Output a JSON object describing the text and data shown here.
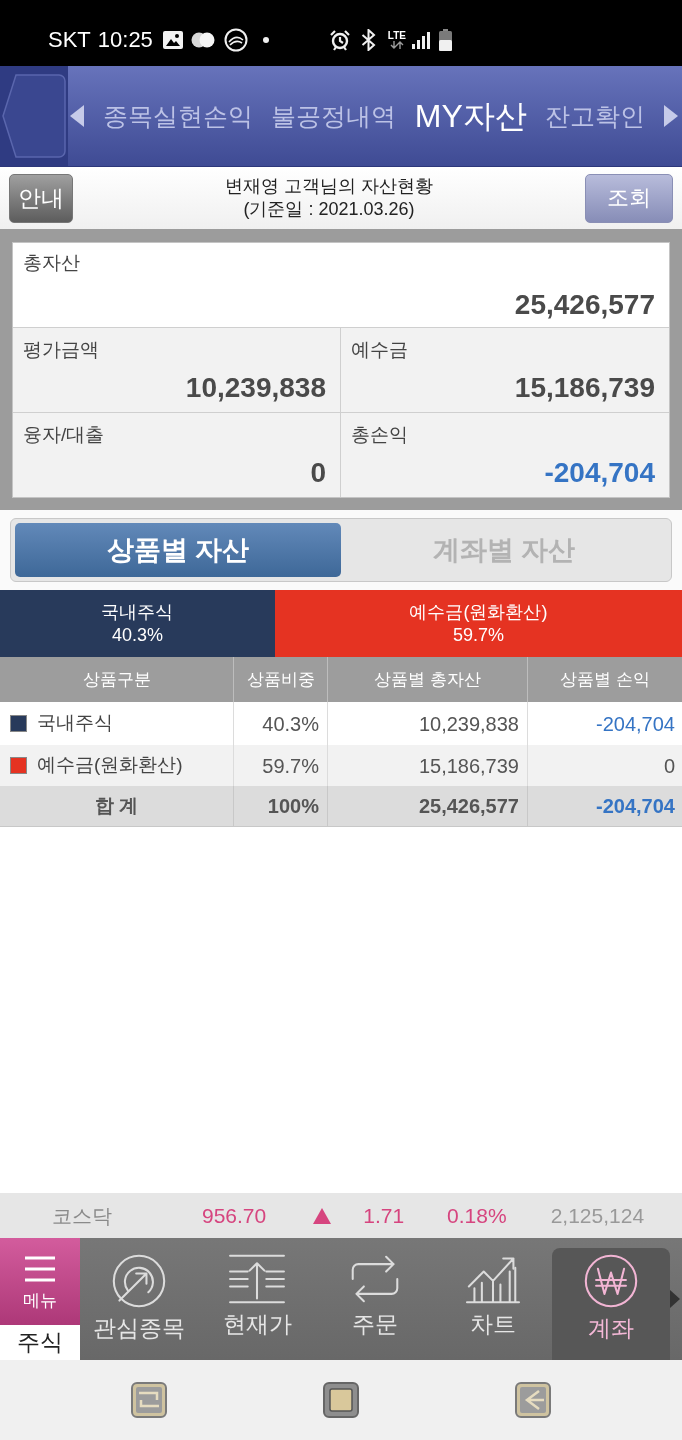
{
  "status_bar": {
    "carrier": "SKT",
    "time": "10:25",
    "network": "LTE"
  },
  "header": {
    "tabs": [
      {
        "label": "종목실현손익",
        "selected": false
      },
      {
        "label": "불공정내역",
        "selected": false
      },
      {
        "label": "MY자산",
        "selected": true
      },
      {
        "label": "잔고확인",
        "selected": false
      }
    ]
  },
  "title_bar": {
    "guide_button": "안내",
    "title": "변재영 고객님의 자산현황",
    "subtitle": "(기준일 : 2021.03.26)",
    "query_button": "조회"
  },
  "summary": {
    "total": {
      "label": "총자산",
      "value": "25,426,577"
    },
    "cells": [
      {
        "label": "평가금액",
        "value": "10,239,838",
        "negative": false
      },
      {
        "label": "예수금",
        "value": "15,186,739",
        "negative": false
      },
      {
        "label": "융자/대출",
        "value": "0",
        "negative": false
      },
      {
        "label": "총손익",
        "value": "-204,704",
        "negative": true
      }
    ]
  },
  "asset_tabs": [
    {
      "label": "상품별 자산",
      "selected": true
    },
    {
      "label": "계좌별 자산",
      "selected": false
    }
  ],
  "allocation": [
    {
      "name": "국내주식",
      "share": "40.3%",
      "level": 0.403,
      "color": "#283a5b"
    },
    {
      "name": "예수금(원화환산)",
      "share": "59.7%",
      "level": 0.597,
      "color": "#e53322"
    }
  ],
  "table": {
    "columns": [
      "상품구분",
      "상품비중",
      "상품별 총자산",
      "상품별 손익"
    ],
    "rows": [
      {
        "name": "국내주식",
        "color": "#283a5b",
        "weight": "40.3%",
        "total": "10,239,838",
        "profit": "-204,704",
        "negative": true
      },
      {
        "name": "예수금(원화환산)",
        "color": "#e53322",
        "weight": "59.7%",
        "total": "15,186,739",
        "profit": "0",
        "negative": false
      }
    ],
    "total_row": {
      "label": "합 계",
      "weight": "100%",
      "total": "25,426,577",
      "profit": "-204,704",
      "negative": true
    }
  },
  "ticker": {
    "index": "코스닥",
    "price": "956.70",
    "rising": true,
    "change": "1.71",
    "rate": "0.18%",
    "volume": "2,125,124"
  },
  "bottom_nav": {
    "menu_label": "메뉴",
    "market_label": "주식",
    "items": [
      {
        "label": "관심종목",
        "selected": false
      },
      {
        "label": "현재가",
        "selected": false
      },
      {
        "label": "주문",
        "selected": false
      },
      {
        "label": "차트",
        "selected": false
      },
      {
        "label": "계좌",
        "selected": true
      }
    ]
  }
}
